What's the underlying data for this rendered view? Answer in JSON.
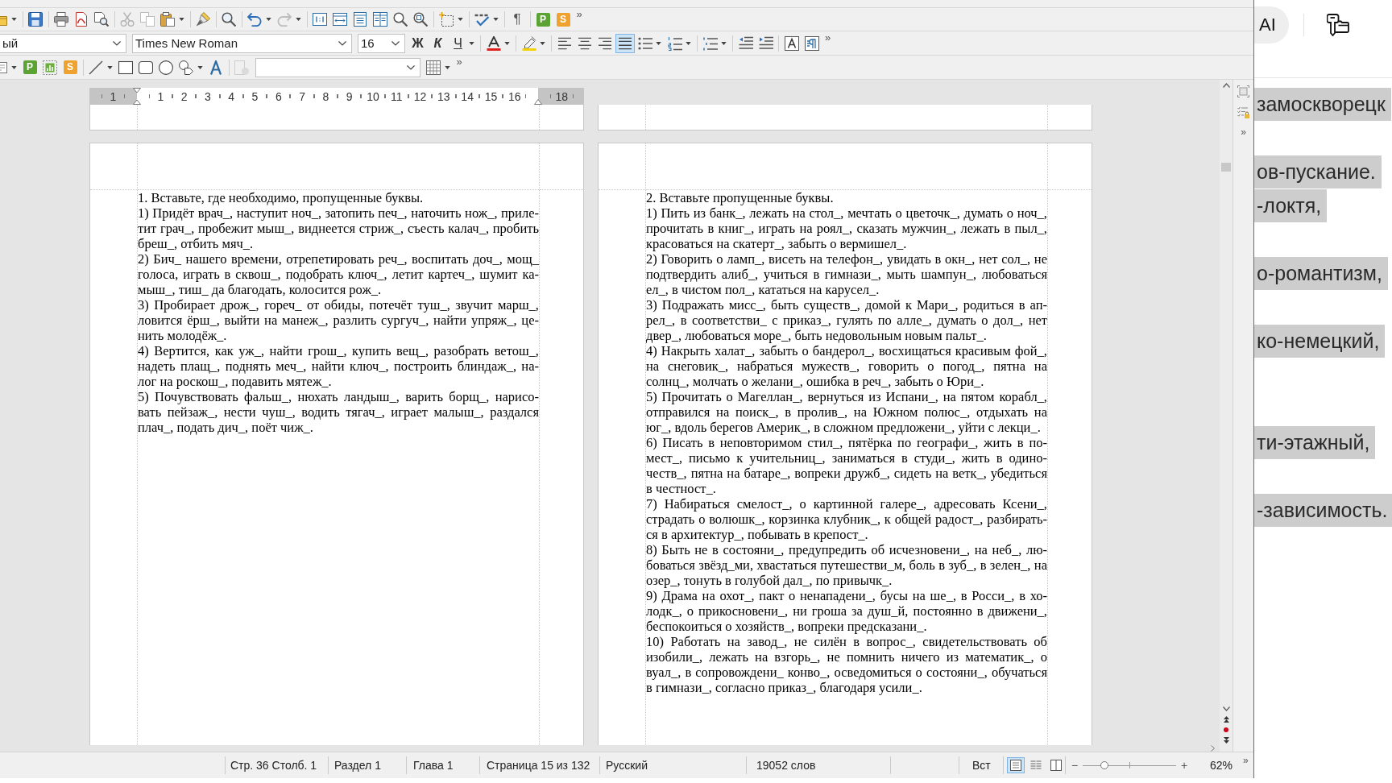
{
  "standard_toolbar": {
    "formatting_marks": "¶",
    "extensions": [
      {
        "label": "P",
        "color": "#5ba433"
      },
      {
        "label": "S",
        "color": "#f0a22e"
      }
    ],
    "overflow": "»"
  },
  "formatting_toolbar": {
    "paragraph_style": "ый",
    "font_name": "Times New Roman",
    "font_size": "16",
    "bold": "Ж",
    "italic": "К",
    "underline": "Ч",
    "alignment": [
      {
        "kind": "left",
        "selected": false
      },
      {
        "kind": "center",
        "selected": false
      },
      {
        "kind": "right",
        "selected": false
      },
      {
        "kind": "justify",
        "selected": true
      }
    ],
    "overflow": "»"
  },
  "drawing_toolbar": {
    "extensions": [
      {
        "label": "P",
        "color": "#5ba433"
      },
      {
        "label": "S",
        "color": "#f0a22e"
      }
    ],
    "overflow": "»"
  },
  "ruler": {
    "left_labels": [
      "1"
    ],
    "labels": [
      "1",
      "2",
      "3",
      "4",
      "5",
      "6",
      "7",
      "8",
      "9",
      "10",
      "11",
      "12",
      "13",
      "14",
      "15",
      "16"
    ],
    "right_labels": [
      "18"
    ]
  },
  "pages": [
    {
      "paragraphs": [
        {
          "lines": [
            "1. Вставьте, где необходимо, пропущенные буквы."
          ]
        },
        {
          "lines": [
            "1) Придёт врач_, наступит ноч_, затопить печ_, наточить нож_, приле-",
            "тит грач_, пробежит мыш_, виднеется стриж_, съесть калач_, пробить",
            "бреш_, отбить мяч_."
          ]
        },
        {
          "lines": [
            "2) Бич_ нашего времени, отрепетировать реч_, воспитать доч_, мощ_",
            "голоса, играть в сквош_, подобрать ключ_, летит картеч_, шумит ка-",
            "мыш_, тиш_ да благодать, колосится рож_."
          ]
        },
        {
          "lines": [
            "3) Пробирает дрож_, гореч_ от обиды, потечёт туш_, звучит марш_,",
            "ловится ёрш_, выйти на манеж_, разлить сургуч_, найти упряж_, це-",
            "нить молодёж_."
          ]
        },
        {
          "lines": [
            "4) Вертится, как уж_, найти грош_, купить вещ_, разобрать ветош_,",
            "надеть плащ_, поднять меч_, найти ключ_, построить блиндаж_, на-",
            "лог на роскош_, подавить мятеж_."
          ]
        },
        {
          "lines": [
            "5) Почувствовать фальш_, нюхать ландыш_, варить борщ_, нарисо-",
            "вать пейзаж_, нести чуш_, водить тягач_, играет малыш_, раздался",
            "плач_, подать дич_, поёт чиж_."
          ]
        }
      ]
    },
    {
      "paragraphs": [
        {
          "lines": [
            "2. Вставьте пропущенные буквы."
          ]
        },
        {
          "lines": [
            "1) Пить из банк_, лежать на стол_, мечтать о цветочк_, думать о ноч_,",
            "прочитать в книг_, играть на роял_, сказать мужчин_, лежать в пыл_,",
            "красоваться на скатерт_, забыть о вермишел_."
          ]
        },
        {
          "lines": [
            "2) Говорить о ламп_, висеть на телефон_, увидать в окн_, нет сол_, не",
            "подтвердить алиб_, учиться в гимнази_, мыть шампун_, любоваться",
            "ел_, в чистом пол_, кататься на карусел_."
          ]
        },
        {
          "lines": [
            "3) Подражать мисс_, быть существ_, домой к Мари_, родиться в ап-",
            "рел_, в соответстви_ с приказ_, гулять по алле_, думать о дол_, нет",
            "двер_, любоваться море_, быть недовольным новым пальт_."
          ]
        },
        {
          "lines": [
            "4) Накрыть халат_, забыть о бандерол_, восхищаться красивым фой_,",
            "на снеговик_, набраться мужеств_, говорить о погод_, пятна на",
            "солнц_, молчать о желани_, ошибка в реч_, забыть о Юри_."
          ]
        },
        {
          "lines": [
            "5) Прочитать о Магеллан_, вернуться из Испани_, на пятом корабл_,",
            "отправился на поиск_, в пролив_, на Южном полюс_, отдыхать на",
            "юг_, вдоль берегов Америк_, в сложном предложени_, уйти с лекци_."
          ]
        },
        {
          "lines": [
            "6) Писать в неповторимом стил_, пятёрка по географи_, жить в по-",
            "мест_, письмо к учительниц_, заниматься в студи_, жить в одино-",
            "честв_, пятна на батаре_, вопреки дружб_, сидеть на ветк_, убедиться",
            "в честност_."
          ]
        },
        {
          "lines": [
            "7) Набираться смелост_, о картинной галере_, адресовать Ксени_,",
            "страдать о волюшк_, корзинка клубник_, к общей радост_, разбирать-",
            "ся в архитектур_, побывать в крепост_."
          ]
        },
        {
          "lines": [
            "8) Быть не в состояни_, предупредить об исчезновени_, на неб_, лю-",
            "боваться звёзд_ми, хвастаться путешестви_м, боль в зуб_, в зелен_, на",
            "озер_, тонуть в голубой дал_, по привычк_."
          ]
        },
        {
          "lines": [
            "9) Драма на охот_, пакт о ненападени_, бусы на ше_, в Росси_, в хо-",
            "лодк_, о прикосновени_, ни гроша за душ_й, постоянно в движени_,",
            "беспокоиться о хозяйств_, вопреки предсказани_."
          ]
        },
        {
          "lines": [
            "10) Работать на завод_, не силён в вопрос_, свидетельствовать об",
            "изобили_, лежать на взгорь_, не помнить ничего из математик_, о",
            "вуал_, в сопровождени_ конво_, осведомиться о состояни_, обучаться",
            "в гимнази_, согласно приказ_, благодаря усили_."
          ]
        }
      ]
    }
  ],
  "sidebar": {
    "overflow": "»"
  },
  "status_bar": {
    "items": [
      "Стр. 36 Столб. 1",
      "Раздел 1",
      "Глава 1",
      "Страница 15 из 132",
      "Русский",
      "19052 слов",
      "Вст"
    ],
    "view_layouts": [
      {
        "kind": "single",
        "selected": true
      },
      {
        "kind": "multi",
        "selected": false
      },
      {
        "kind": "book",
        "selected": false
      }
    ],
    "zoom": {
      "minus": "−",
      "plus": "+",
      "level": 0.23,
      "value": "62%"
    },
    "overflow": "»"
  },
  "side_window": {
    "ai_button": "AI",
    "text_lines": [
      "замоскворецк",
      "ов-пускание.",
      "-локтя,",
      "о-романтизм,",
      "ко-немецкий,",
      "ти-этажный,",
      "-зависимость."
    ]
  }
}
